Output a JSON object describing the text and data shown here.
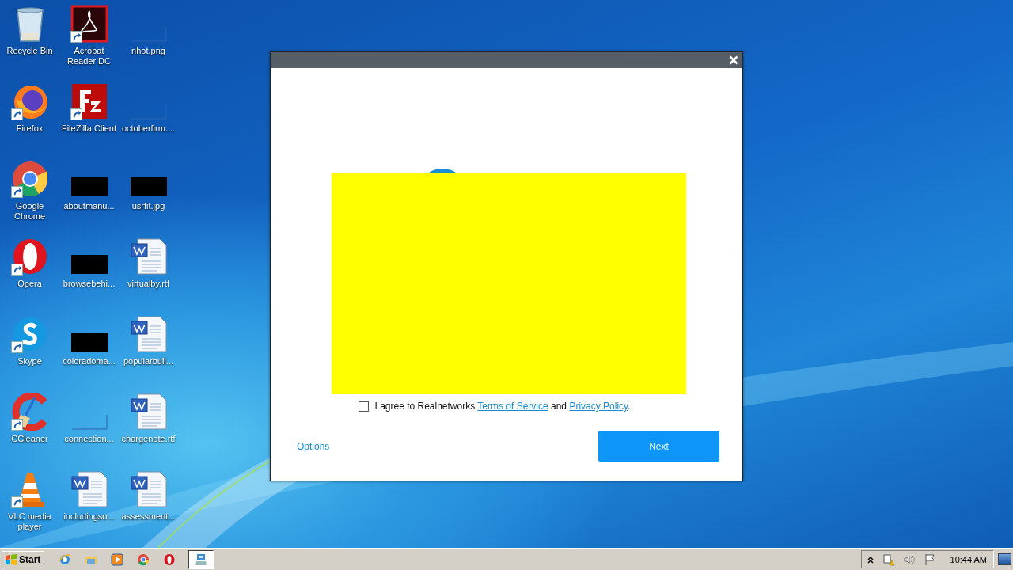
{
  "desktop_icons": [
    {
      "label": "Recycle Bin",
      "kind": "recycle",
      "shortcut": false
    },
    {
      "label": "Acrobat Reader DC",
      "kind": "acrobat",
      "shortcut": true
    },
    {
      "label": "nhot.png",
      "kind": "blank",
      "shortcut": false
    },
    {
      "label": "Firefox",
      "kind": "firefox",
      "shortcut": true
    },
    {
      "label": "FileZilla Client",
      "kind": "filezilla",
      "shortcut": true
    },
    {
      "label": "octoberfirm....",
      "kind": "blank",
      "shortcut": false
    },
    {
      "label": "Google Chrome",
      "kind": "chrome",
      "shortcut": true
    },
    {
      "label": "aboutmanu...",
      "kind": "dark",
      "shortcut": false
    },
    {
      "label": "usrfit.jpg",
      "kind": "dark",
      "shortcut": false
    },
    {
      "label": "Opera",
      "kind": "opera",
      "shortcut": true
    },
    {
      "label": "browsebehi...",
      "kind": "dark",
      "shortcut": false
    },
    {
      "label": "virtualby.rtf",
      "kind": "word",
      "shortcut": false
    },
    {
      "label": "Skype",
      "kind": "skype",
      "shortcut": true
    },
    {
      "label": "coloradoma...",
      "kind": "dark",
      "shortcut": false
    },
    {
      "label": "popularbuil...",
      "kind": "word",
      "shortcut": false
    },
    {
      "label": "CCleaner",
      "kind": "ccleaner",
      "shortcut": true
    },
    {
      "label": "connection...",
      "kind": "blank",
      "shortcut": false
    },
    {
      "label": "chargenote.rtf",
      "kind": "word",
      "shortcut": false
    },
    {
      "label": "VLC media player",
      "kind": "vlc",
      "shortcut": true
    },
    {
      "label": "includingso...",
      "kind": "word",
      "shortcut": false
    },
    {
      "label": "assessment...",
      "kind": "word",
      "shortcut": false
    }
  ],
  "dialog": {
    "agree_checked": false,
    "agree_before": "I agree to Realnetworks",
    "terms_link": "Terms of Service",
    "agree_and": "and",
    "privacy_link": "Privacy Policy",
    "agree_end": ".",
    "options": "Options",
    "next": "Next"
  },
  "taskbar": {
    "start": "Start",
    "quick_launch": [
      {
        "kind": "ie"
      },
      {
        "kind": "folder"
      },
      {
        "kind": "media"
      },
      {
        "kind": "chrome"
      },
      {
        "kind": "opera"
      }
    ],
    "tasks": [
      {
        "kind": "installer",
        "selected": true
      }
    ],
    "tray": [
      {
        "kind": "chevron"
      },
      {
        "kind": "network"
      },
      {
        "kind": "volume"
      },
      {
        "kind": "flag"
      }
    ],
    "clock": "10:44 AM"
  }
}
